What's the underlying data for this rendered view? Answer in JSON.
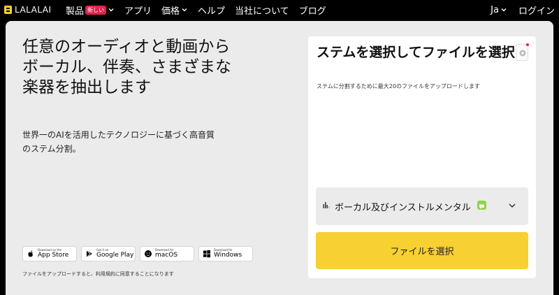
{
  "brand": {
    "name": "LALALAI",
    "accent": "#f5d02e"
  },
  "nav": {
    "items": [
      {
        "label": "製品",
        "badge": "新しい",
        "has_dropdown": true
      },
      {
        "label": "アプリ"
      },
      {
        "label": "価格",
        "has_dropdown": true
      },
      {
        "label": "ヘルプ"
      },
      {
        "label": "当社について"
      },
      {
        "label": "ブログ"
      }
    ],
    "language": "Ja",
    "login": "ログイン"
  },
  "hero": {
    "headline": "任意のオーディオと動画からボーカル、伴奏、さまざまな楽器を抽出します",
    "subtext": "世界一のAIを活用したテクノロジーに基づく高音質のステム分割。",
    "stores": [
      {
        "small": "Download on the",
        "big": "App Store",
        "icon": "apple-icon"
      },
      {
        "small": "Get it on",
        "big": "Google Play",
        "icon": "google-play-icon"
      },
      {
        "small": "Download for",
        "big": "macOS",
        "icon": "macos-icon"
      },
      {
        "small": "Download for",
        "big": "Windows",
        "icon": "windows-icon"
      }
    ],
    "terms": "ファイルをアップロードすると、利用規約に同意することになります"
  },
  "upload": {
    "title": "ステムを選択してファイルを選択",
    "description": "ステムに分割するために最大20のファイルをアップロードします",
    "stem_option": "ボーカル及びインストルメンタル",
    "button": "ファイルを選択",
    "button_color": "#f7d032"
  }
}
